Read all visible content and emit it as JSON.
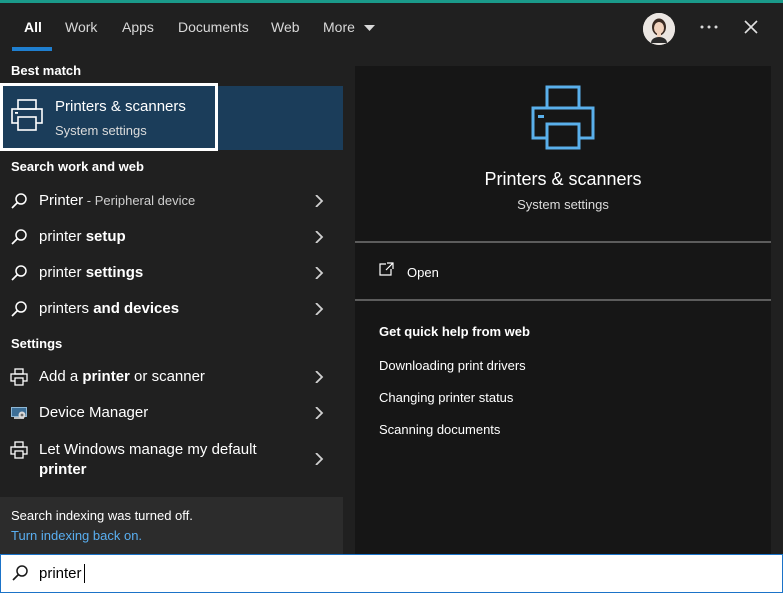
{
  "tabs": [
    {
      "label": "All"
    },
    {
      "label": "Work"
    },
    {
      "label": "Apps"
    },
    {
      "label": "Documents"
    },
    {
      "label": "Web"
    },
    {
      "label": "More"
    }
  ],
  "header": {
    "more_menu_icon": "ellipsis-icon",
    "close_icon": "close-icon"
  },
  "best_match": {
    "heading": "Best match",
    "title": "Printers & scanners",
    "subtitle": "System settings"
  },
  "search_web": {
    "heading": "Search work and web",
    "items": [
      {
        "main": "Printer",
        "sep": " - ",
        "rest": "Peripheral device"
      },
      {
        "main": "printer ",
        "bold": "setup"
      },
      {
        "main": "printer ",
        "bold": "settings"
      },
      {
        "main": "printers ",
        "bold": "and devices"
      }
    ]
  },
  "settings": {
    "heading": "Settings",
    "items": [
      {
        "pre": "Add a ",
        "bold": "printer",
        "post": " or scanner"
      },
      {
        "label": "Device Manager"
      },
      {
        "line1": "Let Windows manage my default",
        "line2": "printer"
      }
    ]
  },
  "footer": {
    "notice": "Search indexing was turned off.",
    "link": "Turn indexing back on."
  },
  "preview": {
    "title": "Printers & scanners",
    "subtitle": "System settings",
    "open_label": "Open",
    "quick_help_heading": "Get quick help from web",
    "links": [
      "Downloading print drivers",
      "Changing printer status",
      "Scanning documents"
    ]
  },
  "search": {
    "value": "printer"
  },
  "colors": {
    "accent": "#1f7fd0",
    "link": "#59aef0",
    "selected": "#1b3d5a",
    "printer_icon": "#5ab0ec"
  }
}
